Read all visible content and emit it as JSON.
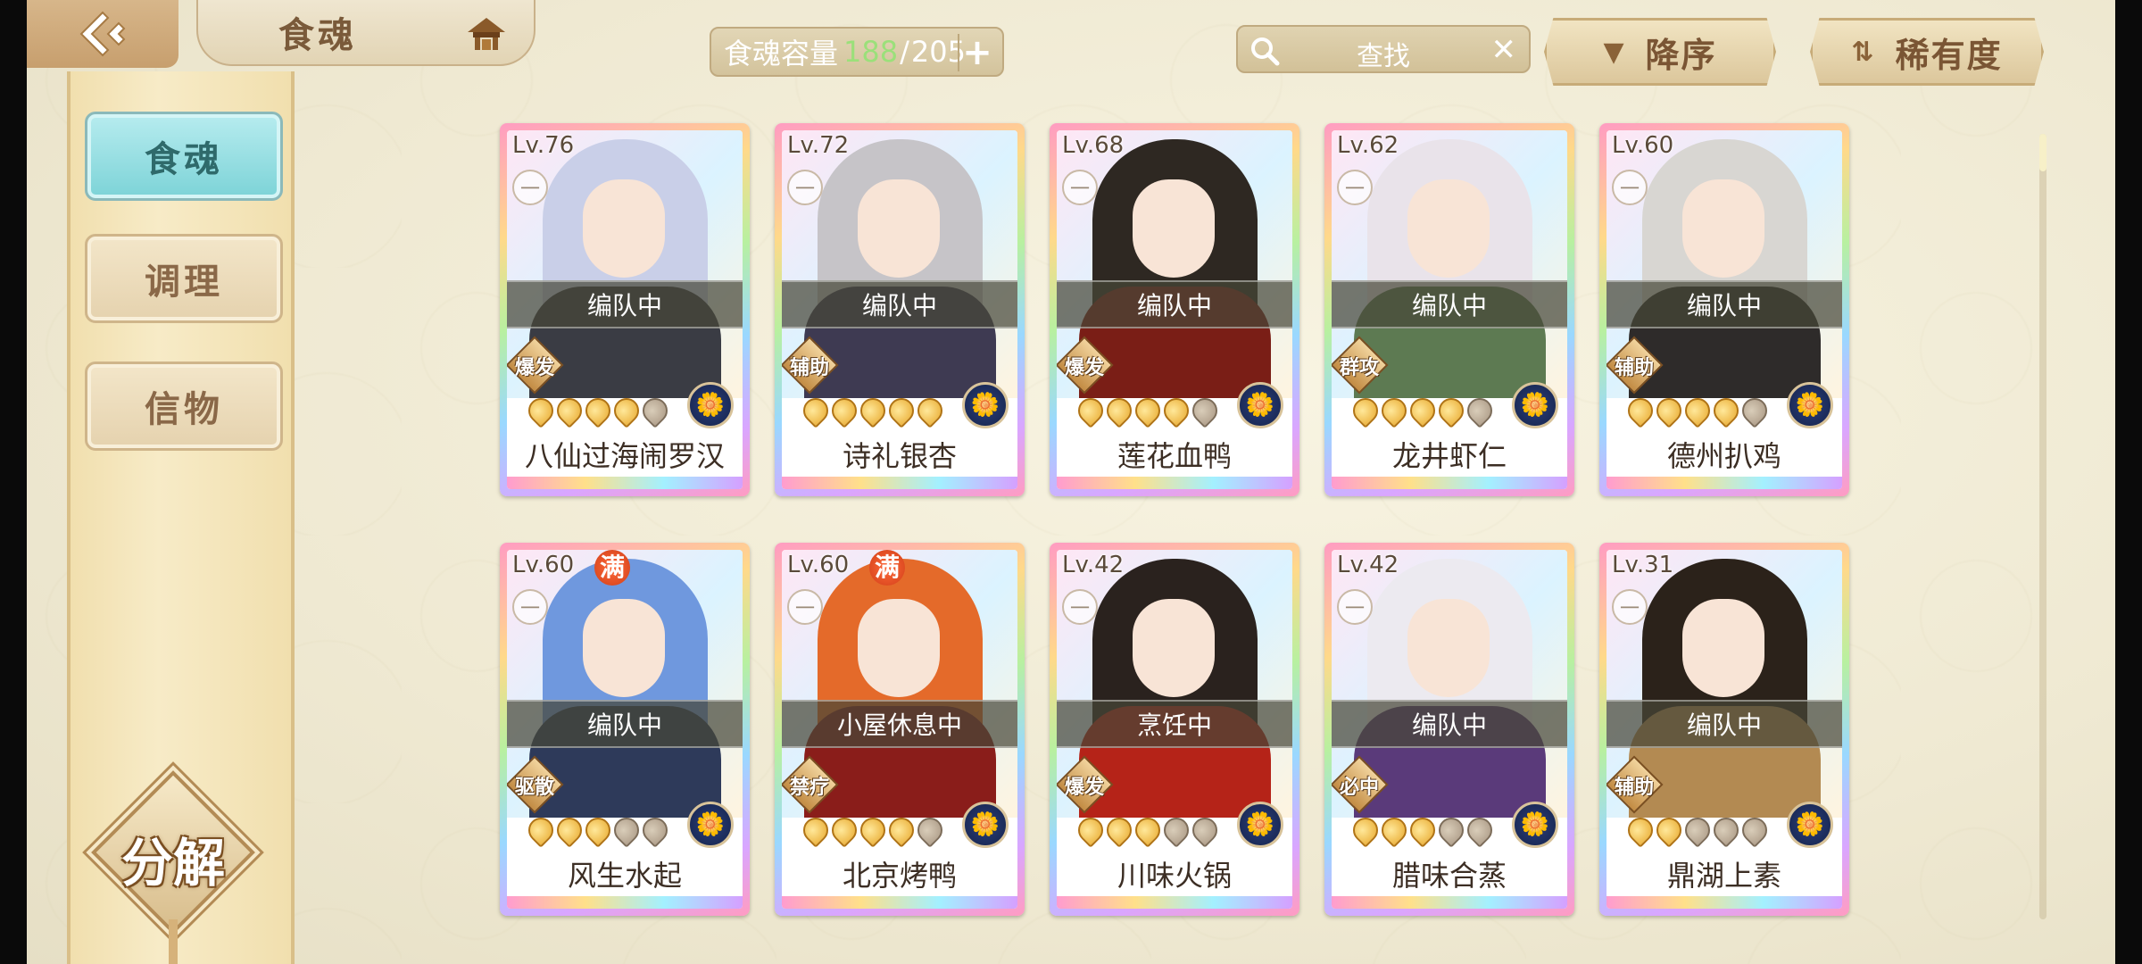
{
  "header": {
    "title": "食魂",
    "capacity_label": "食魂容量",
    "capacity_current": "188",
    "capacity_max": "205",
    "search_placeholder": "查找",
    "sort_order": "降序",
    "sort_by": "稀有度"
  },
  "sidebar": {
    "items": [
      {
        "label": "食魂",
        "active": true
      },
      {
        "label": "调理",
        "active": false
      },
      {
        "label": "信物",
        "active": false
      }
    ],
    "dismantle_label": "分解"
  },
  "cards": [
    {
      "level": "Lv.76",
      "full": "",
      "status": "编队中",
      "role": "爆发",
      "stars": 4,
      "name": "八仙过海闹罗汉",
      "hair": "#c9cfe8",
      "body": "#3a3c44"
    },
    {
      "level": "Lv.72",
      "full": "",
      "status": "编队中",
      "role": "辅助",
      "stars": 5,
      "name": "诗礼银杏",
      "hair": "#c6c4c8",
      "body": "#3e3a52"
    },
    {
      "level": "Lv.68",
      "full": "",
      "status": "编队中",
      "role": "爆发",
      "stars": 4,
      "name": "莲花血鸭",
      "hair": "#2e2822",
      "body": "#7a1e16"
    },
    {
      "level": "Lv.62",
      "full": "",
      "status": "编队中",
      "role": "群攻",
      "stars": 4,
      "name": "龙井虾仁",
      "hair": "#e9e3ea",
      "body": "#5d7a52"
    },
    {
      "level": "Lv.60",
      "full": "",
      "status": "编队中",
      "role": "辅助",
      "stars": 4,
      "name": "德州扒鸡",
      "hair": "#d8d6d2",
      "body": "#2e2b2a"
    },
    {
      "level": "Lv.60",
      "full": "满",
      "status": "编队中",
      "role": "驱散",
      "stars": 3,
      "name": "风生水起",
      "hair": "#6f98de",
      "body": "#2e3a5a"
    },
    {
      "level": "Lv.60",
      "full": "满",
      "status": "小屋休息中",
      "role": "禁疗",
      "stars": 4,
      "name": "北京烤鸭",
      "hair": "#e46a2a",
      "body": "#8a1d1a"
    },
    {
      "level": "Lv.42",
      "full": "",
      "status": "烹饪中",
      "role": "爆发",
      "stars": 3,
      "name": "川味火锅",
      "hair": "#2a221e",
      "body": "#b52318"
    },
    {
      "level": "Lv.42",
      "full": "",
      "status": "编队中",
      "role": "必中",
      "stars": 3,
      "name": "腊味合蒸",
      "hair": "#eceaf0",
      "body": "#5a3a7a"
    },
    {
      "level": "Lv.31",
      "full": "",
      "status": "编队中",
      "role": "辅助",
      "stars": 2,
      "name": "鼎湖上素",
      "hair": "#2b221a",
      "body": "#b38a52"
    }
  ],
  "colors": {
    "accent_teal": "#7cd3d7",
    "capacity_current": "#9be07a",
    "gold": "#e8a92e"
  },
  "icons": {
    "back": "back-arrow-icon",
    "home": "pavilion-icon",
    "search": "magnifier-icon",
    "clear": "close-icon",
    "sort_desc": "triangle-down-icon",
    "sort_rarity": "sort-icon"
  }
}
